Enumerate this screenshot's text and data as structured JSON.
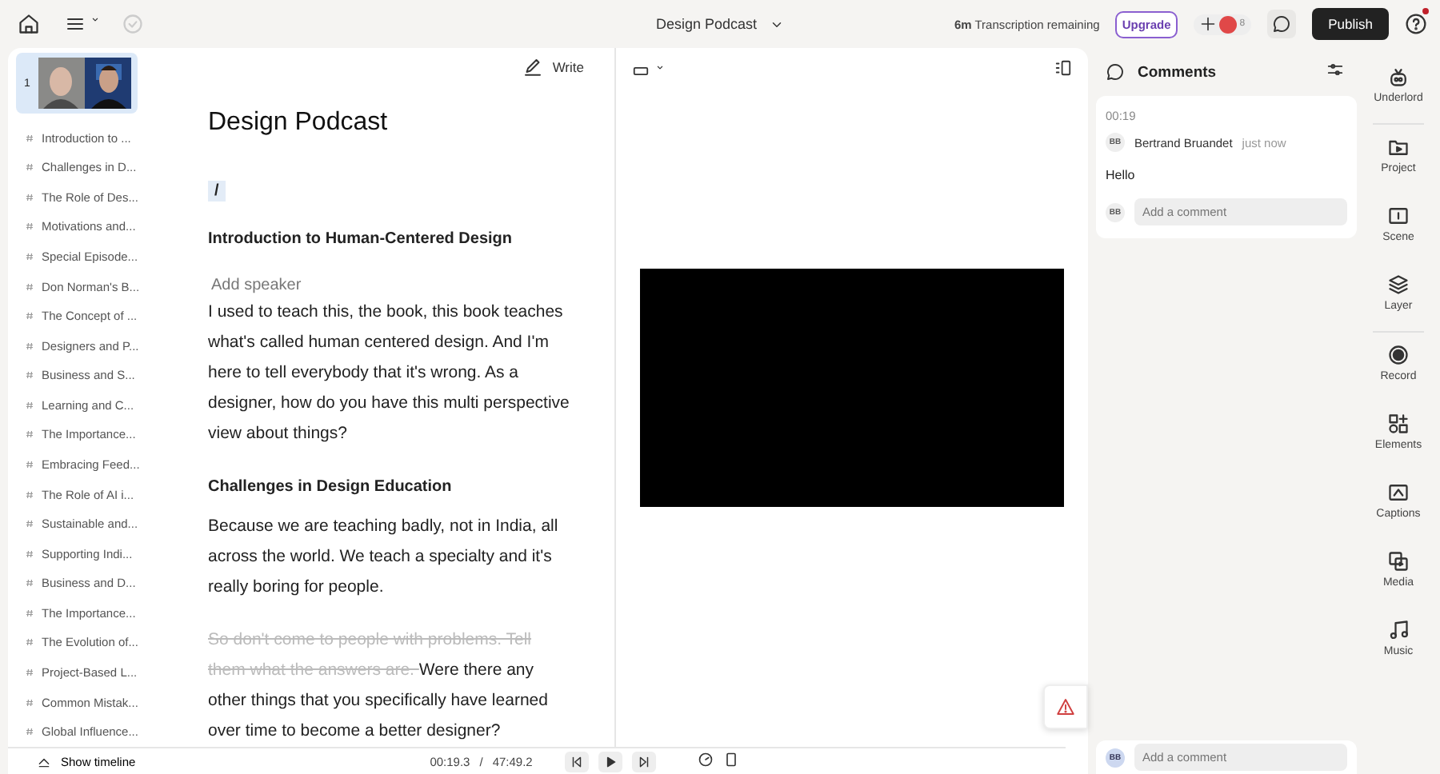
{
  "topbar": {
    "title": "Design Podcast",
    "quota": "**6m** Transcription remaining",
    "upgrade": "Upgrade",
    "collaborator_count": "8",
    "publish": "Publish"
  },
  "scenes": {
    "thumbnail_number": "1",
    "items": [
      "Introduction to ...",
      "Challenges in D...",
      "The Role of Des...",
      "Motivations and...",
      "Special Episode...",
      "Don Norman's B...",
      "The Concept of ...",
      "Designers and P...",
      "Business and S...",
      "Learning and C...",
      "The Importance...",
      "Embracing Feed...",
      "The Role of AI i...",
      "Sustainable and...",
      "Supporting Indi...",
      "Business and D...",
      "The Importance...",
      "The Evolution of...",
      "Project-Based L...",
      "Common Mistak...",
      "Global Influence..."
    ]
  },
  "editor": {
    "write": "Write",
    "title": "Design Podcast",
    "slash": "/",
    "blocks": [
      {
        "kind": "heading",
        "text": "Introduction to Human-Centered Design"
      },
      {
        "kind": "speaker",
        "text": "Add speaker"
      },
      {
        "kind": "paragraph",
        "segments": [
          {
            "text": "I used to teach this, the book, this book teaches what's called human centered design. And I'm here to tell everybody that it's wrong. As a designer, how do you have this multi perspective view about things?",
            "deleted": false
          }
        ]
      },
      {
        "kind": "heading",
        "text": "Challenges in Design Education"
      },
      {
        "kind": "paragraph",
        "segments": [
          {
            "text": "Because we are teaching badly, not in India, all across the world. We teach a specialty and it's really boring for people.",
            "deleted": false
          }
        ]
      },
      {
        "kind": "paragraph",
        "segments": [
          {
            "text": "So don't come to people with problems. Tell them what the answers are. ",
            "deleted": true
          },
          {
            "text": "Were there any other things that you specifically have learned over time to become a better designer?",
            "deleted": false
          }
        ]
      }
    ]
  },
  "timeline": {
    "show": "Show timeline",
    "current": "00:19.3",
    "separator": "/",
    "total": "47:49.2"
  },
  "comments": {
    "title": "Comments",
    "thread": {
      "time": "00:19",
      "initials": "BB",
      "author": "Bertrand Bruandet",
      "when": "just now",
      "body": "Hello",
      "reply_initials": "BB",
      "reply_placeholder": "Add a comment"
    },
    "composer": {
      "initials": "BB",
      "placeholder": "Add a comment"
    }
  },
  "rail": [
    {
      "kind": "robot",
      "label": "Underlord"
    },
    {
      "kind": "folder",
      "label": "Project"
    },
    {
      "kind": "scene",
      "label": "Scene"
    },
    {
      "kind": "layers",
      "label": "Layer"
    },
    {
      "kind": "record",
      "label": "Record"
    },
    {
      "kind": "elements",
      "label": "Elements"
    },
    {
      "kind": "captions",
      "label": "Captions"
    },
    {
      "kind": "media",
      "label": "Media"
    },
    {
      "kind": "music",
      "label": "Music"
    }
  ]
}
